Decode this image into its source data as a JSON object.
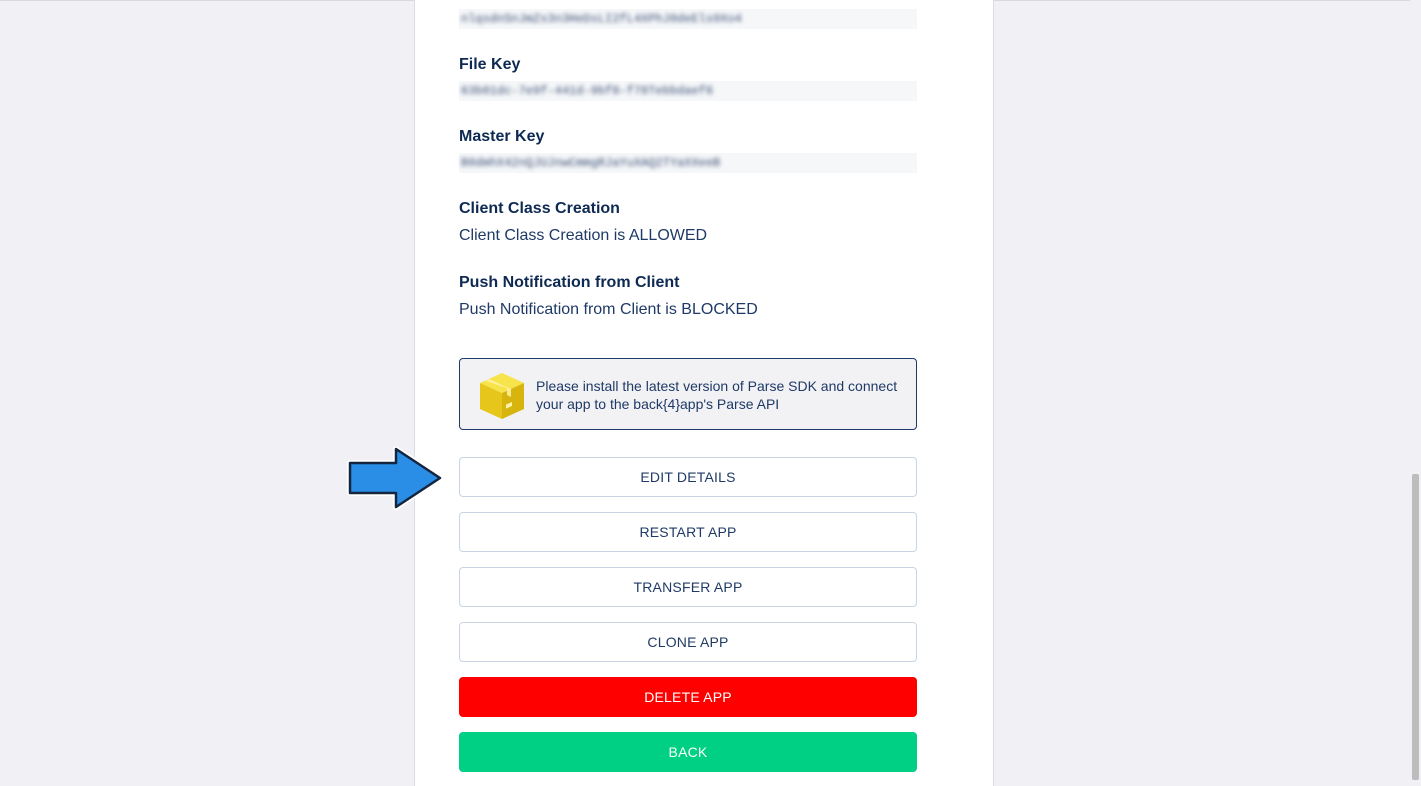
{
  "fields": {
    "client_key_value": "nlqsdnSnJmZs3n3HeDsLI2fL4XPhJ0deEls9Xo4",
    "file_key": {
      "label": "File Key",
      "value": "63b01dc-7e9f-441d-9bf8-f78Tebbdaef6"
    },
    "master_key": {
      "label": "Master Key",
      "value": "B0dmhX42nQJUJnwCmmgRJaYuXAQ2TYaXXeeB"
    },
    "client_class_creation": {
      "label": "Client Class Creation",
      "value": "Client Class Creation is ALLOWED"
    },
    "push_notification": {
      "label": "Push Notification from Client",
      "value": "Push Notification from Client is BLOCKED"
    }
  },
  "notice": {
    "text": "Please install the latest version of Parse SDK and connect your app to the back{4}app's Parse API"
  },
  "buttons": {
    "edit": "EDIT DETAILS",
    "restart": "RESTART APP",
    "transfer": "TRANSFER APP",
    "clone": "CLONE APP",
    "delete": "DELETE APP",
    "back": "BACK"
  },
  "colors": {
    "danger": "#ff0000",
    "success": "#00d084",
    "heading": "#0e2a52",
    "arrow": "#2a8ee6"
  },
  "icons": {
    "notice": "package-box-icon",
    "pointer": "pointer-arrow-icon"
  }
}
